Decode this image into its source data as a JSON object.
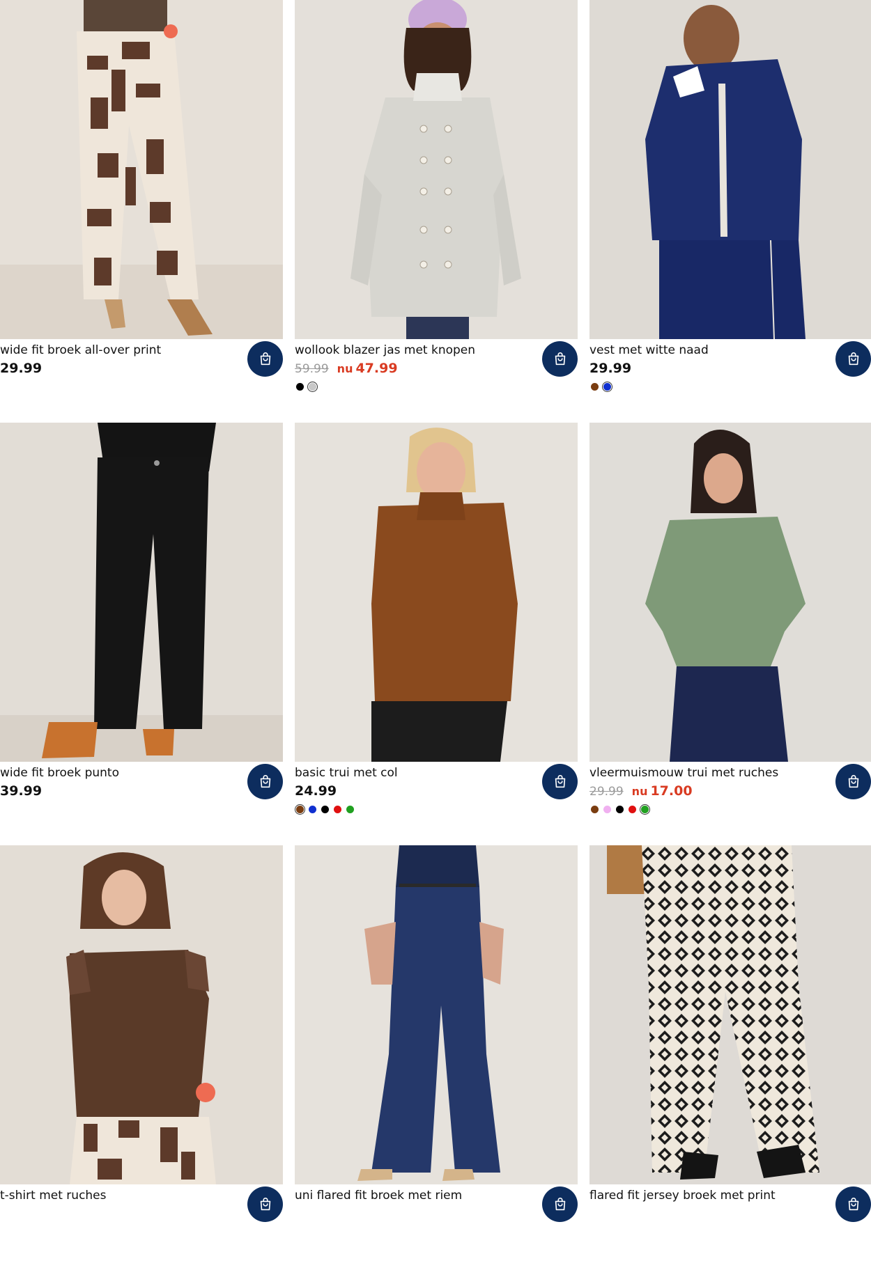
{
  "colors": {
    "accent": "#0d2d5e",
    "sale": "#d93b22",
    "old_price": "#9a9a9a"
  },
  "products": [
    {
      "title": "wide fit broek all-over print",
      "price": "29.99",
      "old_price": null,
      "new_price": null,
      "swatches": []
    },
    {
      "title": "wollook blazer jas met knopen",
      "price": null,
      "old_price": "59.99",
      "new_price_prefix": "nu",
      "new_price": "47.99",
      "swatches": [
        "#000000",
        "#c8c8c8"
      ]
    },
    {
      "title": "vest met witte naad",
      "price": "29.99",
      "old_price": null,
      "new_price": null,
      "swatches": [
        "#7a3d10",
        "#1030d0"
      ]
    },
    {
      "title": "wide fit broek punto",
      "price": "39.99",
      "old_price": null,
      "new_price": null,
      "swatches": []
    },
    {
      "title": "basic trui met col",
      "price": "24.99",
      "old_price": null,
      "new_price": null,
      "swatches": [
        "#7a3d10",
        "#1030d0",
        "#000000",
        "#e01010",
        "#20a020"
      ]
    },
    {
      "title": "vleermuismouw trui met ruches",
      "price": null,
      "old_price": "29.99",
      "new_price_prefix": "nu",
      "new_price": "17.00",
      "swatches": [
        "#7a3d10",
        "#f0b0f0",
        "#000000",
        "#e01010",
        "#20a020"
      ]
    },
    {
      "title": "t-shirt met ruches",
      "price": null,
      "old_price": null,
      "new_price": null,
      "swatches": []
    },
    {
      "title": "uni flared fit broek met riem",
      "price": null,
      "old_price": null,
      "new_price": null,
      "swatches": []
    },
    {
      "title": "flared fit jersey broek met print",
      "price": null,
      "old_price": null,
      "new_price": null,
      "swatches": []
    }
  ],
  "icons": {
    "cart": "shopping-bag-icon"
  }
}
